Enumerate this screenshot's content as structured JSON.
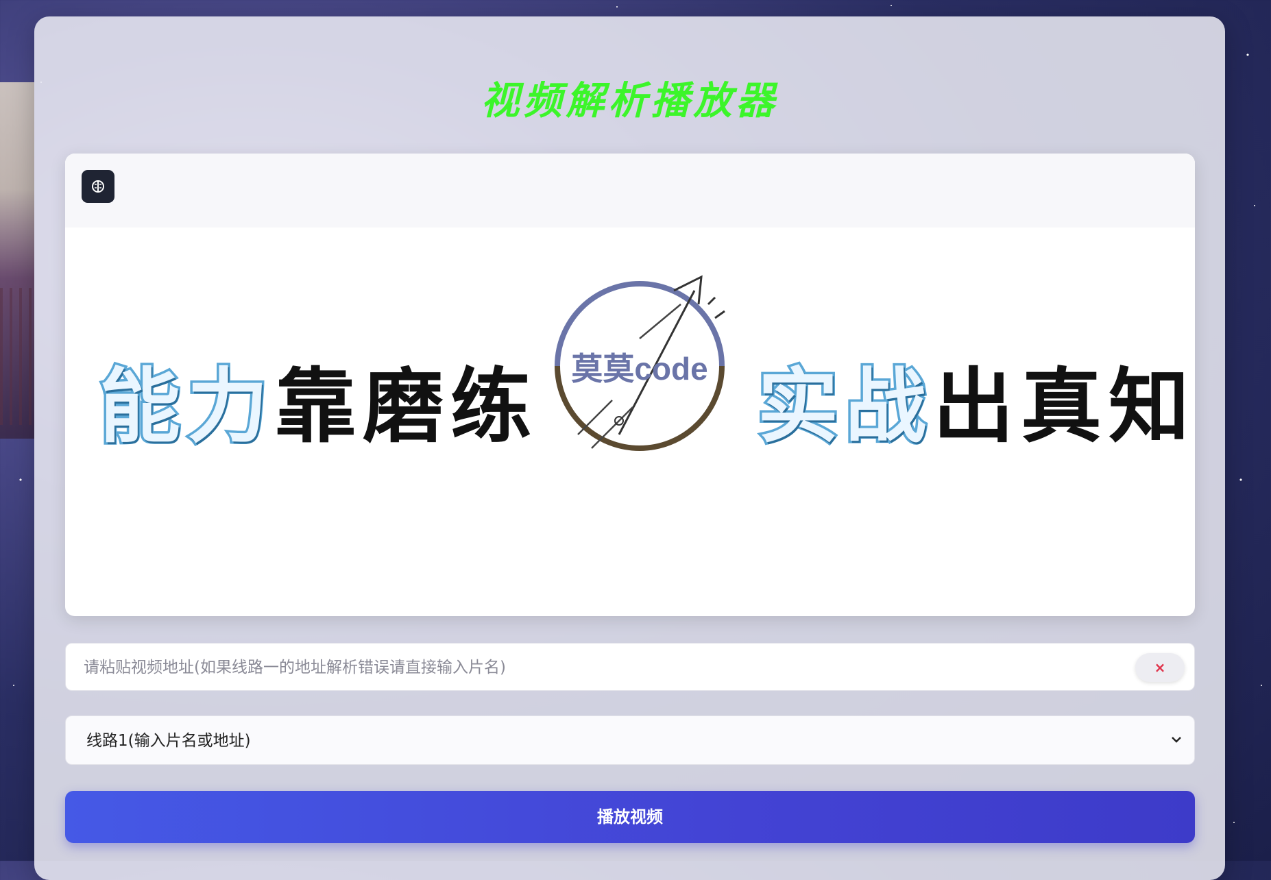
{
  "page": {
    "title": "视频解析播放器"
  },
  "player": {
    "toolbar_icon": "brain-icon",
    "banner": {
      "slogan_left_part1": "能力",
      "slogan_left_part2": "靠磨练",
      "logo_text": "莫莫code",
      "slogan_right_part1": "实战",
      "slogan_right_part2": "出真知"
    }
  },
  "form": {
    "url_placeholder": "请粘贴视频地址(如果线路一的地址解析错误请直接输入片名)",
    "clear_label": "×",
    "line_select_value": "线路1(输入片名或地址)",
    "play_label": "播放视频"
  },
  "colors": {
    "title": "#3cf52a",
    "play_button": "#4451dd",
    "clear_icon": "#e0324a"
  }
}
